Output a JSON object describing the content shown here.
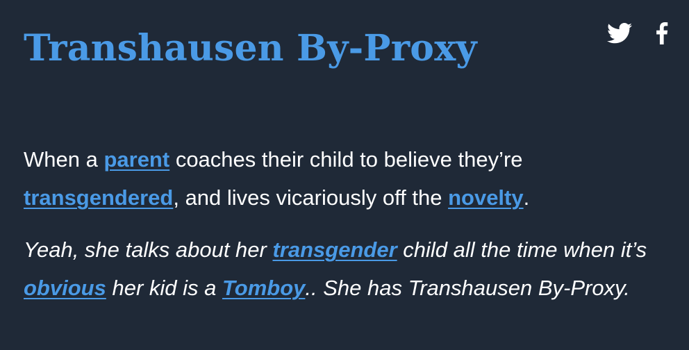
{
  "definition": {
    "title": "Transhausen By-Proxy",
    "meaning": {
      "t1": "When a ",
      "link1": "parent",
      "t2": " coaches their child to believe they’re ",
      "link2": "transgendered",
      "t3": ", and lives vicariously off the ",
      "link3": "novelty",
      "t4": "."
    },
    "example": {
      "t1": "Yeah, she talks about her ",
      "link1": "transgender",
      "t2": " child all the time when it’s ",
      "link2": "obvious",
      "t3": " her kid is a ",
      "link3": "Tomboy",
      "t4": ".. She has Transhausen By-Proxy."
    }
  },
  "share": {
    "icons": [
      "twitter-icon",
      "facebook-icon"
    ]
  },
  "colors": {
    "background": "#1f2937",
    "accent": "#4a9ae6",
    "text": "#ffffff"
  }
}
